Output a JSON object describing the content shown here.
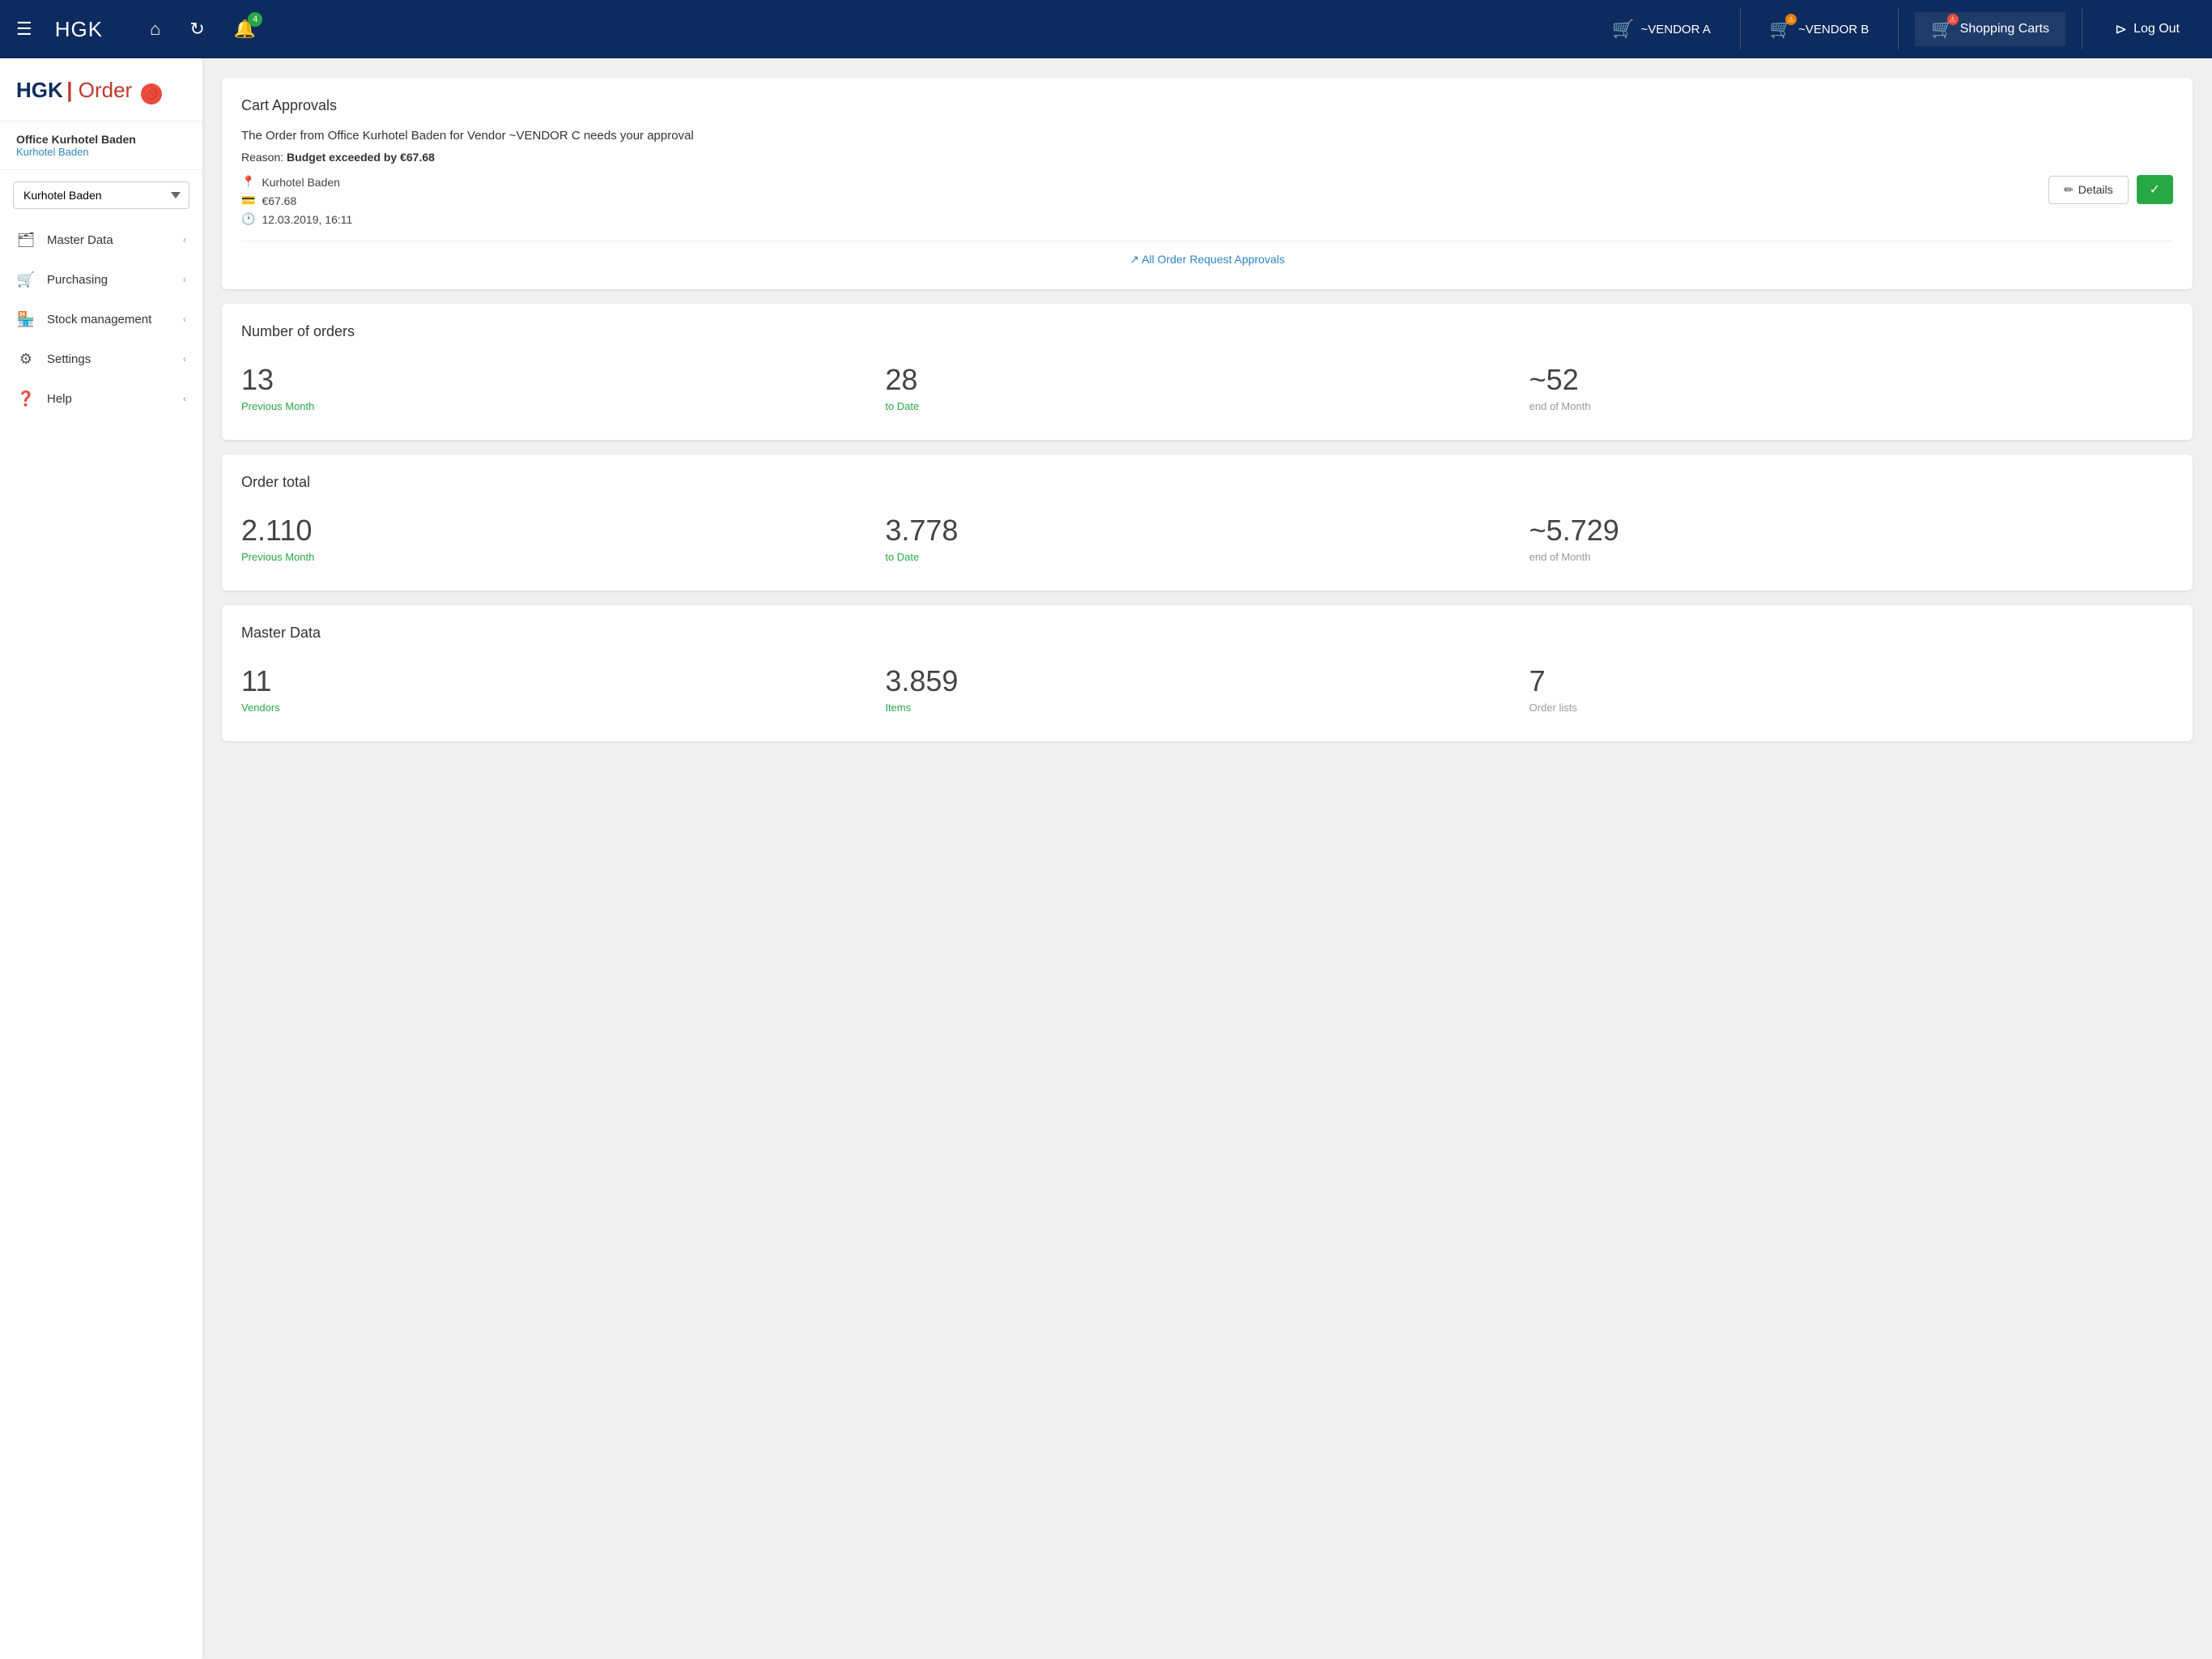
{
  "nav": {
    "brand": "HGK",
    "hamburger_label": "☰",
    "home_icon": "⌂",
    "refresh_icon": "↻",
    "bell_icon": "🔔",
    "bell_badge": "4",
    "vendor_a_label": "~VENDOR A",
    "vendor_b_label": "~VENDOR B",
    "shopping_carts_label": "Shopping Carts",
    "logout_label": "Log Out"
  },
  "sidebar": {
    "logo_hgk": "HGK",
    "logo_pipe": "|",
    "logo_order": "Order",
    "org_name": "Office Kurhotel Baden",
    "org_sub": "Kurhotel Baden",
    "select_value": "Kurhotel Baden",
    "select_options": [
      "Kurhotel Baden"
    ],
    "items": [
      {
        "id": "master-data",
        "label": "Master Data",
        "icon": "🗂"
      },
      {
        "id": "purchasing",
        "label": "Purchasing",
        "icon": "🛒"
      },
      {
        "id": "stock-management",
        "label": "Stock management",
        "icon": "🏪"
      },
      {
        "id": "settings",
        "label": "Settings",
        "icon": "⚙"
      },
      {
        "id": "help",
        "label": "Help",
        "icon": "❓"
      }
    ]
  },
  "cart_approvals": {
    "title": "Cart Approvals",
    "message": "The Order from Office Kurhotel Baden for Vendor ~VENDOR C needs your approval",
    "reason_prefix": "Reason: ",
    "reason_text": "Budget exceeded by €67.68",
    "location": "Kurhotel Baden",
    "amount": "€67.68",
    "timestamp": "12.03.2019, 16:11",
    "details_btn": "Details",
    "approve_btn": "✓",
    "all_approvals_link": "↗ All Order Request Approvals"
  },
  "orders": {
    "title": "Number of orders",
    "stats": [
      {
        "value": "13",
        "label": "Previous Month",
        "gray": false
      },
      {
        "value": "28",
        "label": "to Date",
        "gray": false
      },
      {
        "value": "~52",
        "label": "end of Month",
        "gray": true
      }
    ]
  },
  "order_total": {
    "title": "Order total",
    "stats": [
      {
        "value": "2.110",
        "label": "Previous Month",
        "gray": false
      },
      {
        "value": "3.778",
        "label": "to Date",
        "gray": false
      },
      {
        "value": "~5.729",
        "label": "end of Month",
        "gray": true
      }
    ]
  },
  "master_data": {
    "title": "Master Data",
    "stats": [
      {
        "value": "11",
        "label": "Vendors",
        "gray": false
      },
      {
        "value": "3.859",
        "label": "Items",
        "gray": false
      },
      {
        "value": "7",
        "label": "Order lists",
        "gray": true
      }
    ]
  }
}
